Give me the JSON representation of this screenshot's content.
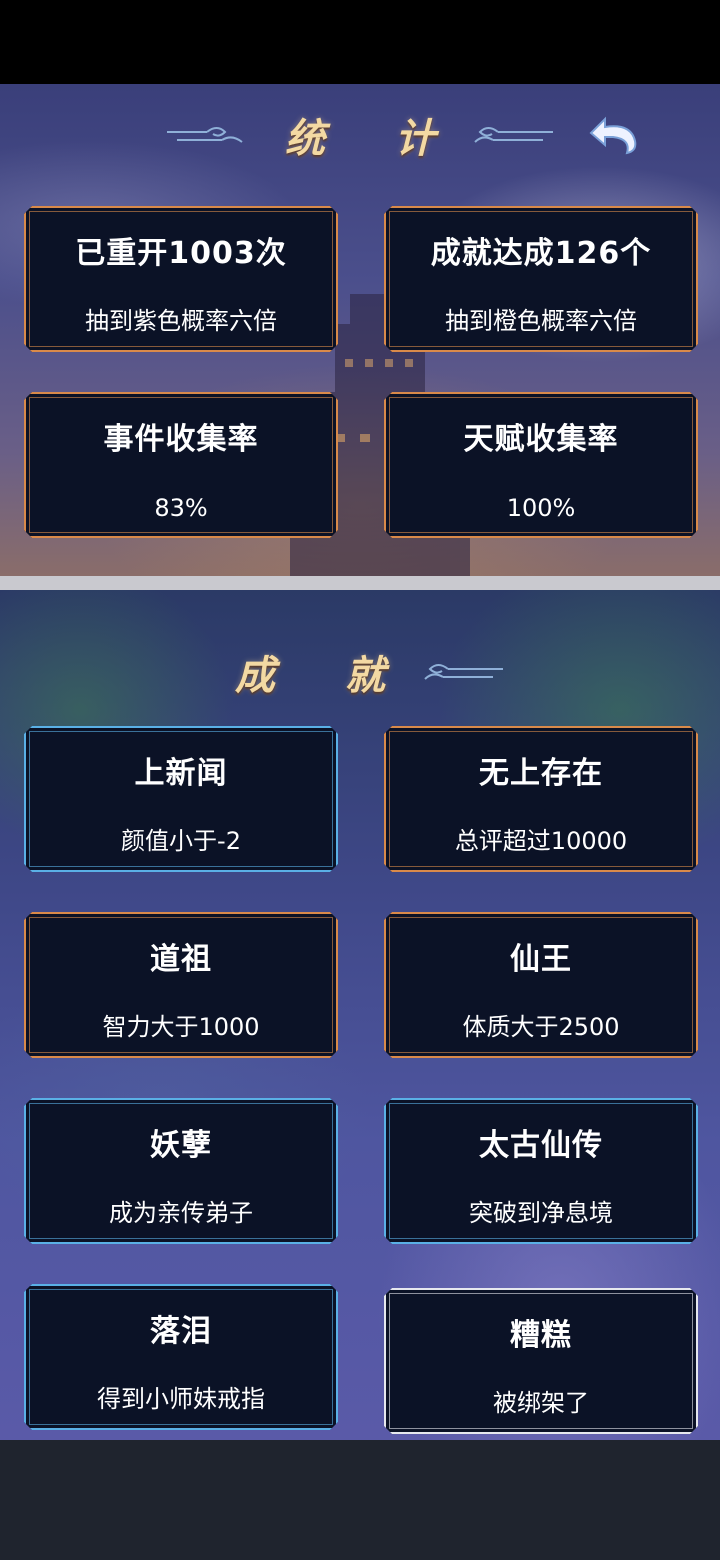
{
  "statistics": {
    "header_title": "统 计",
    "cards": [
      {
        "title": "已重开1003次",
        "sub": "抽到紫色概率六倍"
      },
      {
        "title": "成就达成126个",
        "sub": "抽到橙色概率六倍"
      },
      {
        "title": "事件收集率",
        "sub": "83%"
      },
      {
        "title": "天赋收集率",
        "sub": "100%"
      }
    ]
  },
  "achievements": {
    "header_title": "成 就",
    "cards": [
      {
        "title": "上新闻",
        "sub": "颜值小于-2",
        "rarity_color": "#5ab0e6"
      },
      {
        "title": "无上存在",
        "sub": "总评超过10000",
        "rarity_color": "#d98a4a"
      },
      {
        "title": "道祖",
        "sub": "智力大于1000",
        "rarity_color": "#d98a4a"
      },
      {
        "title": "仙王",
        "sub": "体质大于2500",
        "rarity_color": "#d98a4a"
      },
      {
        "title": "妖孽",
        "sub": "成为亲传弟子",
        "rarity_color": "#5ab0e6"
      },
      {
        "title": "太古仙传",
        "sub": "突破到净息境",
        "rarity_color": "#5ab0e6"
      },
      {
        "title": "落泪",
        "sub": "得到小师妹戒指",
        "rarity_color": "#5ab0e6"
      },
      {
        "title": "糟糕",
        "sub": "被绑架了",
        "rarity_color": "#e6e8ee"
      }
    ]
  },
  "icons": {
    "back": "back-arrow-icon",
    "header_deco": "cloud-ornament-icon"
  }
}
